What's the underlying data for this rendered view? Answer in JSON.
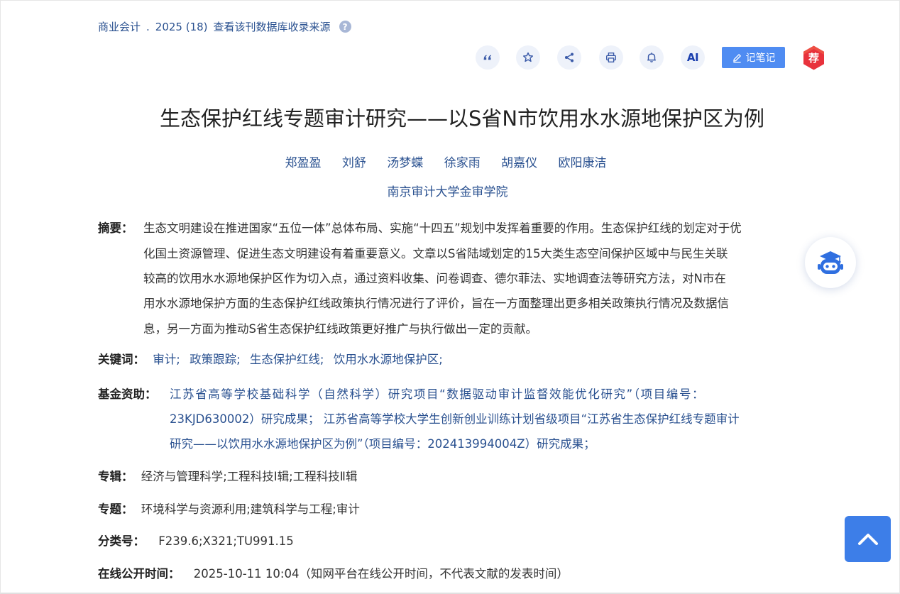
{
  "source": {
    "journal": "商业会计",
    "dot": ".",
    "issue": "2025 (18)",
    "db_link": "查看该刊数据库收录来源",
    "help_glyph": "?"
  },
  "toolbar": {
    "items": [
      "quote-icon",
      "star-icon",
      "share-icon",
      "print-icon",
      "bell-icon",
      "ai-icon"
    ],
    "ai_label": "AI",
    "note_label": "记笔记",
    "recommend_label": "荐",
    "recommend_color": "#e8323c",
    "note_color": "#4f8cf2"
  },
  "title": "生态保护红线专题审计研究——以S省N市饮用水水源地保护区为例",
  "authors": [
    "郑盈盈",
    "刘舒",
    "汤梦蝶",
    "徐家雨",
    "胡嘉仪",
    "欧阳康洁"
  ],
  "affiliation": "南京审计大学金审学院",
  "abstract": {
    "label": "摘要：",
    "lines": [
      "生态文明建设在推进国家“五位一体”总体布局、实施“十四五”规划中发挥着重要的作用。生态保护红线的划定对于优",
      "化国土资源管理、促进生态文明建设有着重要意义。文章以S省陆域划定的15大类生态空间保护区域中与民生关联",
      "较高的饮用水水源地保护区作为切入点，通过资料收集、问卷调查、德尔菲法、实地调查法等研究方法，对N市在",
      "用水水源地保护方面的生态保护红线政策执行情况进行了评价，旨在一方面整理出更多相关政策执行情况及数据信",
      "息，另一方面为推动S省生态保护红线政策更好推广与执行做出一定的贡献。"
    ]
  },
  "keywords": {
    "label": "关键词：",
    "items": [
      "审计;",
      "政策跟踪;",
      "生态保护红线;",
      "饮用水水源地保护区;"
    ]
  },
  "funding": {
    "label": "基金资助：",
    "lines": [
      "江苏省高等学校基础科学（自然科学）研究项目“数据驱动审计监督效能优化研究”（项目编号：",
      "23KJD630002）研究成果；  江苏省高等学校大学生创新创业训练计划省级项目“江苏省生态保护红线专题审计",
      "研究——以饮用水水源地保护区为例”（项目编号：202413994004Z）研究成果；"
    ]
  },
  "series": {
    "label": "专辑：",
    "value": "经济与管理科学;工程科技Ⅰ辑;工程科技Ⅱ辑"
  },
  "topic": {
    "label": "专题：",
    "value": "环境科学与资源利用;建筑科学与工程;审计"
  },
  "classification": {
    "label": "分类号：",
    "value": "F239.6;X321;TU991.15"
  },
  "online_date": {
    "label": "在线公开时间：",
    "value": "2025-10-11 10:04（知网平台在线公开时间，不代表文献的发表时间）"
  },
  "floating": {
    "assistant_icon": "robot-assistant-icon",
    "back_to_top_icon": "chevron-up-icon"
  }
}
